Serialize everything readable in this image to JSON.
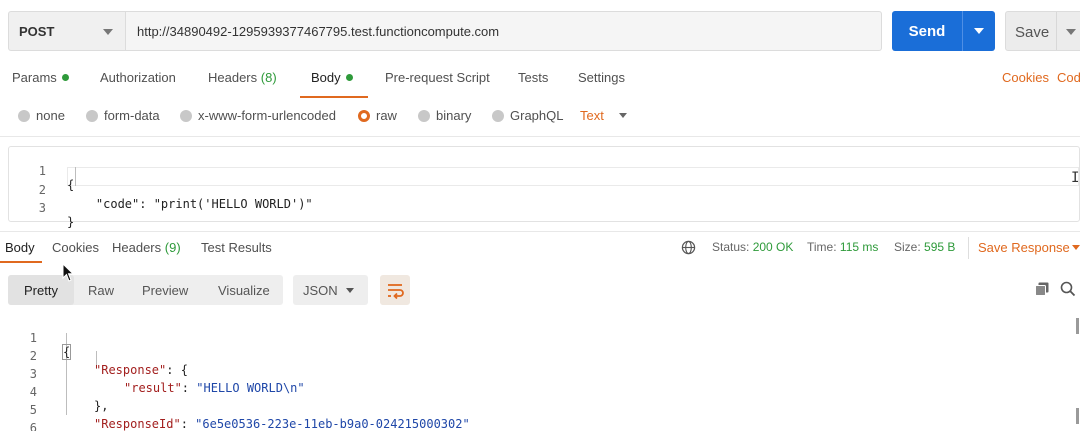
{
  "request": {
    "method": "POST",
    "url": "http://34890492-1295939377467795.test.functioncompute.com",
    "send_label": "Send",
    "save_label": "Save"
  },
  "request_tabs": {
    "params": "Params",
    "authorization": "Authorization",
    "headers": "Headers",
    "headers_count": "(8)",
    "body": "Body",
    "pre_request": "Pre-request Script",
    "tests": "Tests",
    "settings": "Settings",
    "cookies": "Cookies",
    "code": "Code"
  },
  "body_types": {
    "none": "none",
    "form_data": "form-data",
    "urlencoded": "x-www-form-urlencoded",
    "raw": "raw",
    "binary": "binary",
    "graphql": "GraphQL",
    "selected": "raw",
    "format": "Text"
  },
  "request_body": {
    "line_numbers": [
      "1",
      "2",
      "3"
    ],
    "lines": [
      "{",
      "    \"code\": \"print('HELLO WORLD')\"",
      "}"
    ]
  },
  "response_tabs": {
    "body": "Body",
    "cookies": "Cookies",
    "headers": "Headers",
    "headers_count": "(9)",
    "test_results": "Test Results"
  },
  "response_status": {
    "status_label": "Status:",
    "status_value": "200 OK",
    "time_label": "Time:",
    "time_value": "115 ms",
    "size_label": "Size:",
    "size_value": "595 B",
    "save_response": "Save Response"
  },
  "view_modes": {
    "pretty": "Pretty",
    "raw": "Raw",
    "preview": "Preview",
    "visualize": "Visualize",
    "format": "JSON"
  },
  "response_body": {
    "line_numbers": [
      "1",
      "2",
      "3",
      "4",
      "5",
      "6"
    ],
    "open_brace": "{",
    "response_key": "\"Response\"",
    "result_key": "\"result\"",
    "result_value": "\"HELLO WORLD\\n\"",
    "close_inner": "},",
    "response_id_key": "\"ResponseId\"",
    "response_id_value": "\"6e5e0536-223e-11eb-b9a0-024215000302\"",
    "close_brace": "}"
  },
  "colors": {
    "accent": "#e0691f",
    "primary": "#1a6ed8",
    "success": "#2e9a3a",
    "json_key": "#a3201f",
    "json_string": "#1f47a8"
  }
}
